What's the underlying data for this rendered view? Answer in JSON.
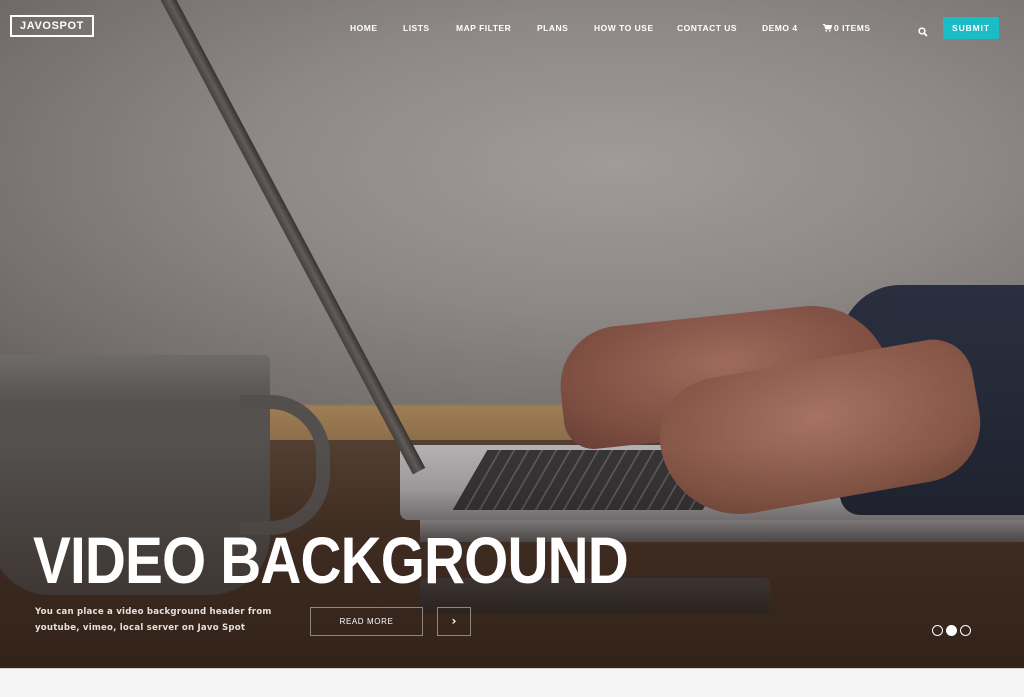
{
  "header": {
    "logo": "JAVOSPOT",
    "nav": [
      {
        "label": "HOME"
      },
      {
        "label": "LISTS"
      },
      {
        "label": "MAP FILTER"
      },
      {
        "label": "PLANS"
      },
      {
        "label": "HOW TO USE"
      },
      {
        "label": "CONTACT US"
      },
      {
        "label": "DEMO 4"
      },
      {
        "label": "0 ITEMS",
        "icon": "cart-icon"
      }
    ],
    "search_icon": "search-icon",
    "submit_label": "SUBMIT",
    "accent_color": "#1bbcc6"
  },
  "hero": {
    "title": "VIDEO BACKGROUND",
    "description": "You can place a video background header from youtube, vimeo, local server on Javo Spot",
    "read_more_label": "READ MORE",
    "next_icon": "chevron-right-icon",
    "next_glyph": "›",
    "slider": {
      "total": 3,
      "active_index": 1
    }
  }
}
